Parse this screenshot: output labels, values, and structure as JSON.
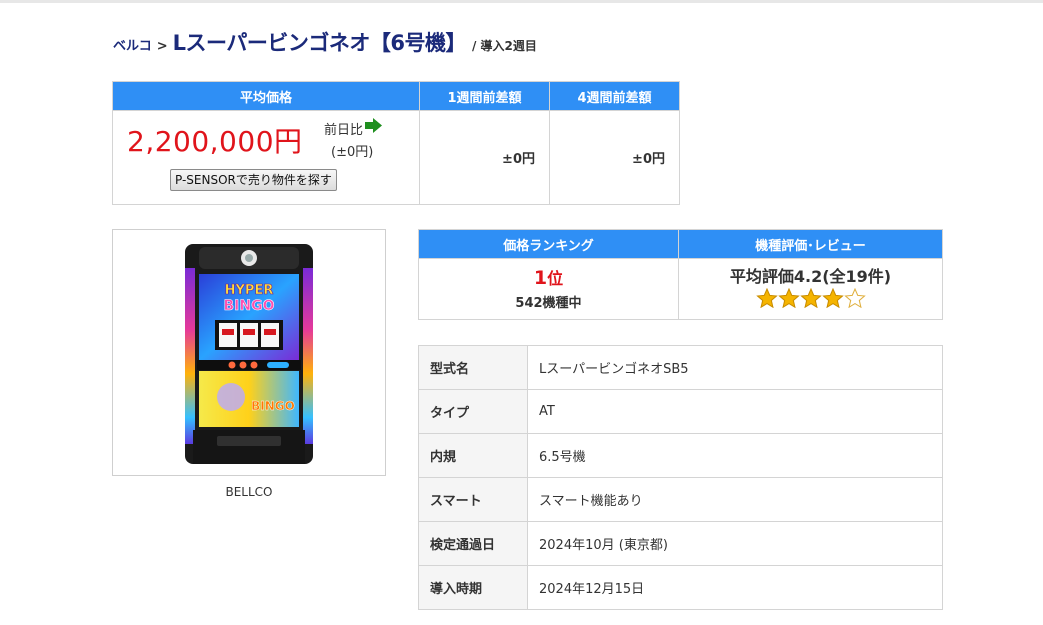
{
  "breadcrumb": {
    "maker": "ベルコ",
    "separator": ">",
    "title": "Lスーパービンゴネオ【6号機】",
    "intro": "/ 導入2週目"
  },
  "price_table": {
    "headers": [
      "平均価格",
      "1週間前差額",
      "4週間前差額"
    ],
    "average_price": "2,200,000円",
    "prev_day_label": "前日比",
    "prev_day_value": "(±0円)",
    "search_button": "P-SENSORで売り物件を探す",
    "diff_1week": "±0円",
    "diff_4week": "±0円"
  },
  "machine": {
    "maker_caption": "BELLCO"
  },
  "ranking": {
    "header_rank": "価格ランキング",
    "header_review": "機種評価･レビュー",
    "rank_number": "1",
    "rank_suffix": "位",
    "rank_of": "542機種中",
    "review_text": "平均評価4.2(全19件)",
    "review_score": 4.2,
    "stars_filled": 4,
    "stars_total": 5
  },
  "specs": [
    {
      "key": "型式名",
      "value": "LスーパービンゴネオSB5"
    },
    {
      "key": "タイプ",
      "value": "AT"
    },
    {
      "key": "内規",
      "value": "6.5号機"
    },
    {
      "key": "スマート",
      "value": "スマート機能あり"
    },
    {
      "key": "検定通過日",
      "value": "2024年10月 (東京都)"
    },
    {
      "key": "導入時期",
      "value": "2024年12月15日"
    }
  ],
  "colors": {
    "header_blue": "#2f8ff5",
    "price_red": "#e0141b",
    "title_navy": "#1b2a7a",
    "arrow_green": "#1f8f1f",
    "star_gold": "#f5b400"
  }
}
